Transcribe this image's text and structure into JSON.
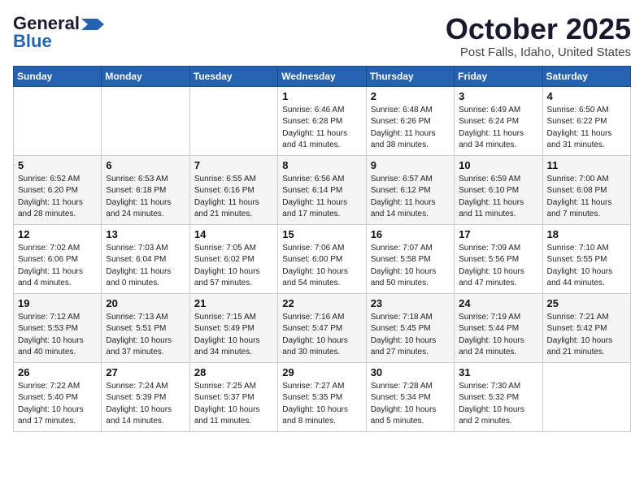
{
  "logo": {
    "general": "General",
    "blue": "Blue"
  },
  "header": {
    "month": "October 2025",
    "location": "Post Falls, Idaho, United States"
  },
  "days_of_week": [
    "Sunday",
    "Monday",
    "Tuesday",
    "Wednesday",
    "Thursday",
    "Friday",
    "Saturday"
  ],
  "weeks": [
    [
      {
        "day": "",
        "info": ""
      },
      {
        "day": "",
        "info": ""
      },
      {
        "day": "",
        "info": ""
      },
      {
        "day": "1",
        "info": "Sunrise: 6:46 AM\nSunset: 6:28 PM\nDaylight: 11 hours and 41 minutes."
      },
      {
        "day": "2",
        "info": "Sunrise: 6:48 AM\nSunset: 6:26 PM\nDaylight: 11 hours and 38 minutes."
      },
      {
        "day": "3",
        "info": "Sunrise: 6:49 AM\nSunset: 6:24 PM\nDaylight: 11 hours and 34 minutes."
      },
      {
        "day": "4",
        "info": "Sunrise: 6:50 AM\nSunset: 6:22 PM\nDaylight: 11 hours and 31 minutes."
      }
    ],
    [
      {
        "day": "5",
        "info": "Sunrise: 6:52 AM\nSunset: 6:20 PM\nDaylight: 11 hours and 28 minutes."
      },
      {
        "day": "6",
        "info": "Sunrise: 6:53 AM\nSunset: 6:18 PM\nDaylight: 11 hours and 24 minutes."
      },
      {
        "day": "7",
        "info": "Sunrise: 6:55 AM\nSunset: 6:16 PM\nDaylight: 11 hours and 21 minutes."
      },
      {
        "day": "8",
        "info": "Sunrise: 6:56 AM\nSunset: 6:14 PM\nDaylight: 11 hours and 17 minutes."
      },
      {
        "day": "9",
        "info": "Sunrise: 6:57 AM\nSunset: 6:12 PM\nDaylight: 11 hours and 14 minutes."
      },
      {
        "day": "10",
        "info": "Sunrise: 6:59 AM\nSunset: 6:10 PM\nDaylight: 11 hours and 11 minutes."
      },
      {
        "day": "11",
        "info": "Sunrise: 7:00 AM\nSunset: 6:08 PM\nDaylight: 11 hours and 7 minutes."
      }
    ],
    [
      {
        "day": "12",
        "info": "Sunrise: 7:02 AM\nSunset: 6:06 PM\nDaylight: 11 hours and 4 minutes."
      },
      {
        "day": "13",
        "info": "Sunrise: 7:03 AM\nSunset: 6:04 PM\nDaylight: 11 hours and 0 minutes."
      },
      {
        "day": "14",
        "info": "Sunrise: 7:05 AM\nSunset: 6:02 PM\nDaylight: 10 hours and 57 minutes."
      },
      {
        "day": "15",
        "info": "Sunrise: 7:06 AM\nSunset: 6:00 PM\nDaylight: 10 hours and 54 minutes."
      },
      {
        "day": "16",
        "info": "Sunrise: 7:07 AM\nSunset: 5:58 PM\nDaylight: 10 hours and 50 minutes."
      },
      {
        "day": "17",
        "info": "Sunrise: 7:09 AM\nSunset: 5:56 PM\nDaylight: 10 hours and 47 minutes."
      },
      {
        "day": "18",
        "info": "Sunrise: 7:10 AM\nSunset: 5:55 PM\nDaylight: 10 hours and 44 minutes."
      }
    ],
    [
      {
        "day": "19",
        "info": "Sunrise: 7:12 AM\nSunset: 5:53 PM\nDaylight: 10 hours and 40 minutes."
      },
      {
        "day": "20",
        "info": "Sunrise: 7:13 AM\nSunset: 5:51 PM\nDaylight: 10 hours and 37 minutes."
      },
      {
        "day": "21",
        "info": "Sunrise: 7:15 AM\nSunset: 5:49 PM\nDaylight: 10 hours and 34 minutes."
      },
      {
        "day": "22",
        "info": "Sunrise: 7:16 AM\nSunset: 5:47 PM\nDaylight: 10 hours and 30 minutes."
      },
      {
        "day": "23",
        "info": "Sunrise: 7:18 AM\nSunset: 5:45 PM\nDaylight: 10 hours and 27 minutes."
      },
      {
        "day": "24",
        "info": "Sunrise: 7:19 AM\nSunset: 5:44 PM\nDaylight: 10 hours and 24 minutes."
      },
      {
        "day": "25",
        "info": "Sunrise: 7:21 AM\nSunset: 5:42 PM\nDaylight: 10 hours and 21 minutes."
      }
    ],
    [
      {
        "day": "26",
        "info": "Sunrise: 7:22 AM\nSunset: 5:40 PM\nDaylight: 10 hours and 17 minutes."
      },
      {
        "day": "27",
        "info": "Sunrise: 7:24 AM\nSunset: 5:39 PM\nDaylight: 10 hours and 14 minutes."
      },
      {
        "day": "28",
        "info": "Sunrise: 7:25 AM\nSunset: 5:37 PM\nDaylight: 10 hours and 11 minutes."
      },
      {
        "day": "29",
        "info": "Sunrise: 7:27 AM\nSunset: 5:35 PM\nDaylight: 10 hours and 8 minutes."
      },
      {
        "day": "30",
        "info": "Sunrise: 7:28 AM\nSunset: 5:34 PM\nDaylight: 10 hours and 5 minutes."
      },
      {
        "day": "31",
        "info": "Sunrise: 7:30 AM\nSunset: 5:32 PM\nDaylight: 10 hours and 2 minutes."
      },
      {
        "day": "",
        "info": ""
      }
    ]
  ]
}
